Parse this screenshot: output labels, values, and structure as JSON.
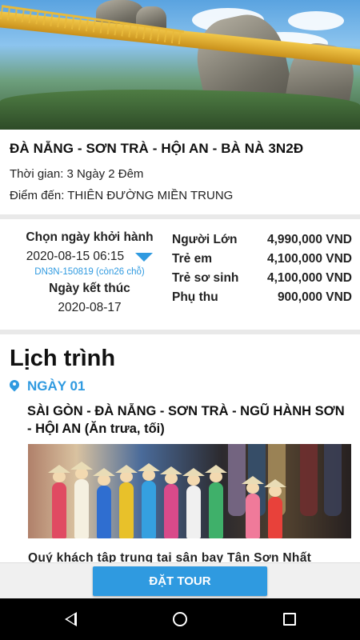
{
  "tour": {
    "title": "ĐÀ NẴNG - SƠN TRÀ - HỘI AN - BÀ NÀ 3N2Đ",
    "duration": "Thời gian: 3 Ngày 2 Đêm",
    "destination": "Điểm đến: THIÊN ĐƯỜNG MIỀN TRUNG"
  },
  "booking": {
    "start_label": "Chọn ngày khởi hành",
    "start_value": "2020-08-15 06:15",
    "code_line": "DN3N-150819 (còn26 chỗ)",
    "end_label": "Ngày kết thúc",
    "end_value": "2020-08-17",
    "prices": [
      {
        "label": "Người Lớn",
        "value": "4,990,000 VND"
      },
      {
        "label": "Trẻ em",
        "value": "4,100,000 VND"
      },
      {
        "label": "Trẻ sơ sinh",
        "value": "4,100,000 VND"
      },
      {
        "label": "Phụ thu",
        "value": "900,000 VND"
      }
    ]
  },
  "itinerary": {
    "title": "Lịch trình",
    "day_label": "NGÀY 01",
    "day_heading": "SÀI GÒN -  ĐÀ NẴNG - SƠN TRÀ - NGŨ HÀNH SƠN - HỘI AN (Ăn trưa, tối)",
    "paragraph": "Quý khách tập trung tại sân bay Tân Sơn Nhất"
  },
  "actions": {
    "book_label": "ĐẶT TOUR"
  },
  "colors": {
    "accent": "#2f9ae0",
    "divider": "#e9e9e9",
    "navbar": "#000000"
  },
  "icons": {
    "caret": "caret-down-icon",
    "pin": "map-pin-icon",
    "nav_back": "back-triangle-icon",
    "nav_home": "home-circle-icon",
    "nav_recents": "recents-square-icon"
  }
}
